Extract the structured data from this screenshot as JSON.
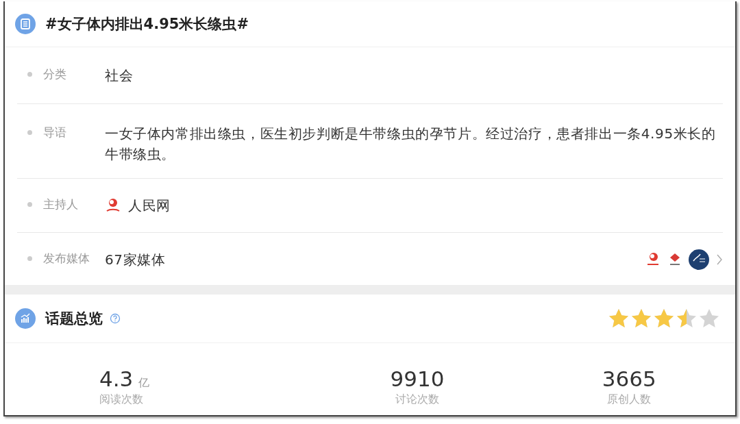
{
  "topic": {
    "title": "#女子体内排出4.95米长绦虫#"
  },
  "details": [
    {
      "kind": "text",
      "label": "分类",
      "value": "社会"
    },
    {
      "kind": "text",
      "label": "导语",
      "value": "一女子体内常排出绦虫，医生初步判断是牛带绦虫的孕节片。经过治疗，患者排出一条4.95米长的牛带绦虫。"
    },
    {
      "kind": "host",
      "label": "主持人",
      "value": "人民网"
    },
    {
      "kind": "media",
      "label": "发布媒体",
      "value": "67家媒体"
    }
  ],
  "overview": {
    "title": "话题总览",
    "stars": 3.5,
    "stats": [
      {
        "value": "4.3",
        "unit": "亿",
        "label": "阅读次数"
      },
      {
        "value": "9910",
        "label": "讨论次数"
      },
      {
        "value": "3665",
        "label": "原创人数"
      }
    ]
  }
}
